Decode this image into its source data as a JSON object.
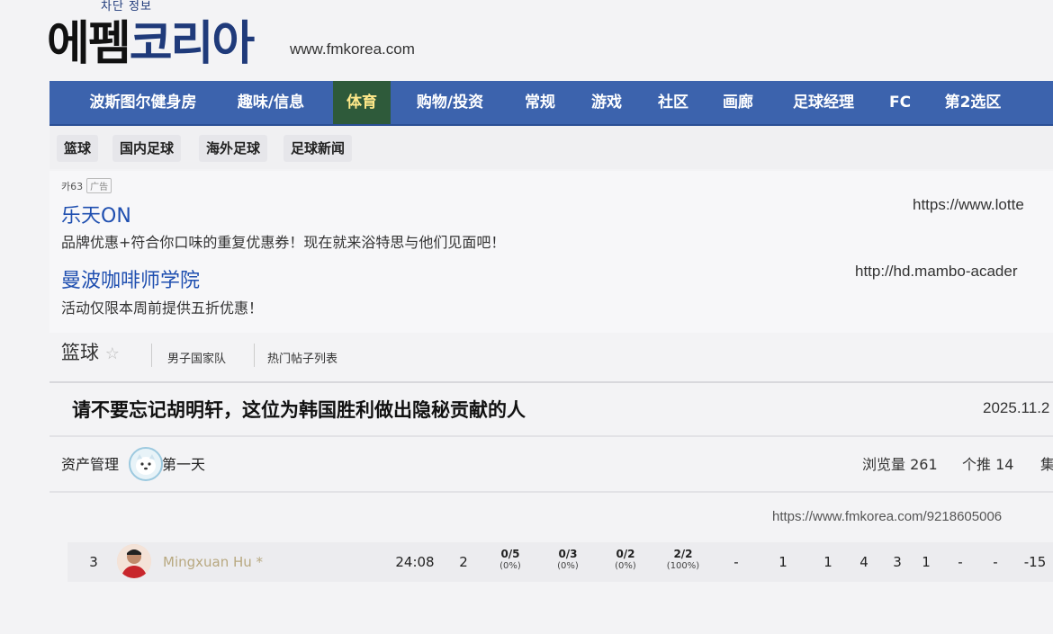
{
  "header": {
    "logo_small": "차단 정보",
    "logo_text_a": "에펨",
    "logo_text_b": "코리아",
    "site_url": "www.fmkorea.com"
  },
  "main_nav": {
    "items": [
      {
        "label": "波斯图尔健身房"
      },
      {
        "label": "趣味/信息"
      },
      {
        "label": "体育",
        "active": true
      },
      {
        "label": "购物/投资"
      },
      {
        "label": "常规"
      },
      {
        "label": "游戏"
      },
      {
        "label": "社区"
      },
      {
        "label": "画廊"
      },
      {
        "label": "足球经理"
      },
      {
        "label": "FC"
      },
      {
        "label": "第2选区"
      }
    ]
  },
  "sub_nav": {
    "items": [
      {
        "label": "篮球"
      },
      {
        "label": "国内足球"
      },
      {
        "label": "海外足球"
      },
      {
        "label": "足球新闻"
      }
    ]
  },
  "ads": {
    "label": "카63",
    "badge": "广告",
    "items": [
      {
        "title": "乐天ON",
        "desc": "品牌优惠+符合你口味的重复优惠券！现在就来浴特思与他们见面吧！",
        "url": "https://www.lotte"
      },
      {
        "title": "曼波咖啡师学院",
        "desc": "活动仅限本周前提供五折优惠！",
        "url": "http://hd.mambo-acader"
      }
    ]
  },
  "board": {
    "title": "篮球",
    "star_icon": "star-outline-icon",
    "links": [
      "男子国家队",
      "热门帖子列表"
    ]
  },
  "post": {
    "title": "请不要忘记胡明轩，这位为韩国胜利做出隐秘贡献的人",
    "date": "2025.11.2",
    "author_prefix": "资产管理",
    "author_suffix": "第一天",
    "views_label": "浏览量",
    "views": "261",
    "recommend_label": "个推",
    "recommend": "14",
    "comments_label_partial": "集",
    "link": "https://www.fmkorea.com/9218605006"
  },
  "stats_row": {
    "number": "3",
    "player": "Mingxuan Hu *",
    "minutes": "24:08",
    "points": "2",
    "fg": {
      "made": "0/5",
      "pct": "(0%)"
    },
    "three": {
      "made": "0/3",
      "pct": "(0%)"
    },
    "ft": {
      "made": "0/2",
      "pct": "(0%)"
    },
    "other": {
      "made": "2/2",
      "pct": "(100%)"
    },
    "tail": [
      "-",
      "1",
      "1",
      "4",
      "3",
      "1",
      "-",
      "-",
      "-15"
    ]
  },
  "colors": {
    "nav_bg": "#3c63ad",
    "nav_active_bg": "#2e5a3a",
    "nav_active_text": "#ffe98a",
    "link_blue": "#1f4fb0"
  }
}
